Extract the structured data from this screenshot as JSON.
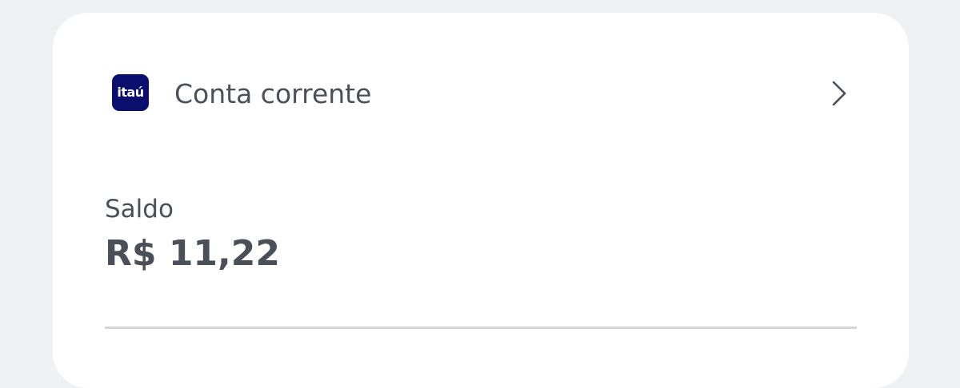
{
  "account": {
    "bank_logo_text": "itaú",
    "label": "Conta corrente",
    "chevron_icon": "chevron-right-icon"
  },
  "balance": {
    "label": "Saldo",
    "value": "R$ 11,22"
  },
  "colors": {
    "background": "#f0f1f3",
    "card": "#ffffff",
    "text": "#4b4f58",
    "brand": "#0a0f6e",
    "divider": "#d4d5d8"
  }
}
